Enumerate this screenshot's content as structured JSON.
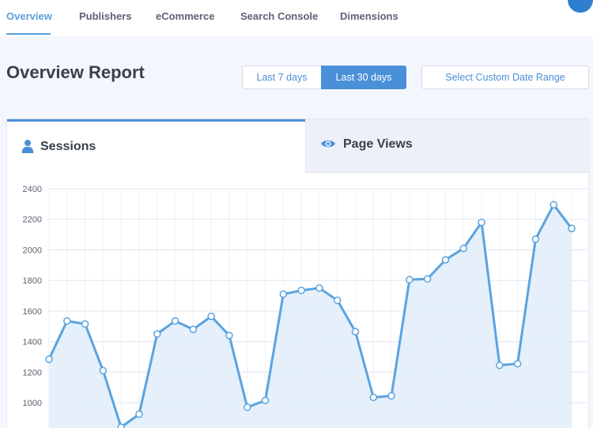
{
  "nav": {
    "tabs": [
      {
        "label": "Overview",
        "active": true
      },
      {
        "label": "Publishers"
      },
      {
        "label": "eCommerce"
      },
      {
        "label": "Search Console"
      },
      {
        "label": "Dimensions"
      }
    ]
  },
  "page": {
    "title": "Overview Report"
  },
  "date_range": {
    "last7": "Last 7 days",
    "last30": "Last 30 days",
    "custom": "Select Custom Date Range",
    "selected": "Last 30 days"
  },
  "tabs": {
    "sessions": {
      "label": "Sessions",
      "icon": "user-icon"
    },
    "pageviews": {
      "label": "Page Views",
      "icon": "eye-icon"
    }
  },
  "colors": {
    "accent": "#4a90d9",
    "line": "#5aa3e0",
    "area": "#e1edf9"
  },
  "chart_data": {
    "type": "area",
    "series": [
      {
        "values": [
          1285,
          1535,
          1515,
          1210,
          840,
          925,
          1450,
          1535,
          1480,
          1565,
          1440,
          970,
          1015,
          1710,
          1735,
          1750,
          1670,
          1465,
          1035,
          1045,
          1805,
          1810,
          1935,
          2010,
          2180,
          1245,
          1255,
          2070,
          2295,
          2140
        ]
      }
    ],
    "yticks": [
      "2400",
      "2200",
      "2000",
      "1800",
      "1600",
      "1400",
      "1200",
      "1000"
    ],
    "ylim": [
      1000,
      2400
    ],
    "grid": true
  }
}
